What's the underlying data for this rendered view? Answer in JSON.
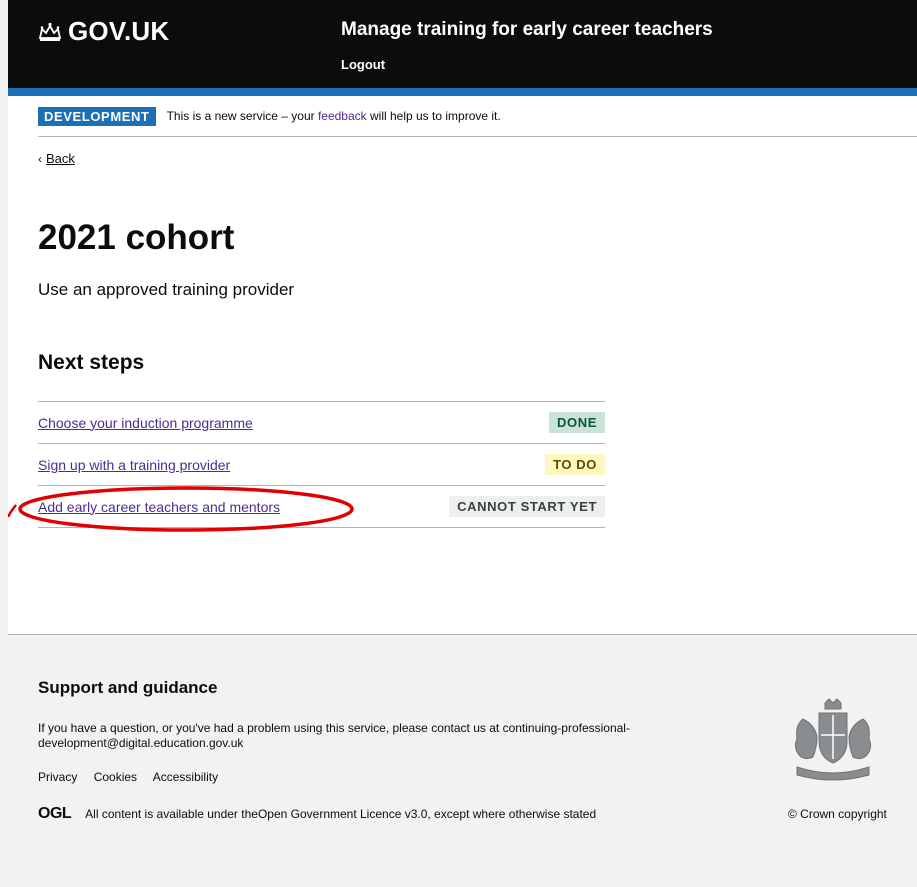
{
  "header": {
    "logo_text": "GOV.UK",
    "service_name": "Manage training for early career teachers",
    "logout": "Logout"
  },
  "phase_banner": {
    "tag": "DEVELOPMENT",
    "text_before": "This is a new service – your ",
    "link": "feedback",
    "text_after": " will help us to improve it."
  },
  "back_link": "Back",
  "main": {
    "title": "2021 cohort",
    "subtitle": "Use an approved training provider",
    "section_title": "Next steps",
    "steps": [
      {
        "label": "Choose your induction programme",
        "status": "DONE"
      },
      {
        "label": "Sign up with a training provider",
        "status": "TO DO"
      },
      {
        "label": "Add early career teachers and mentors",
        "status": "CANNOT START YET"
      }
    ]
  },
  "footer": {
    "title": "Support and guidance",
    "text": "If you have a question, or you've had a problem using this service, please contact us at ",
    "email": "continuing-professional-development@digital.education.gov.uk",
    "links": [
      "Privacy",
      "Cookies",
      "Accessibility"
    ],
    "ogl_logo": "OGL",
    "licence_before": "All content is available under the ",
    "licence_link": "Open Government Licence v3.0",
    "licence_after": ", except where otherwise stated",
    "copyright": "© Crown copyright"
  },
  "colors": {
    "header_bg": "#0b0c0c",
    "brand_blue": "#1d70b8",
    "link": "#4c2c92",
    "annotation": "#e00000"
  }
}
